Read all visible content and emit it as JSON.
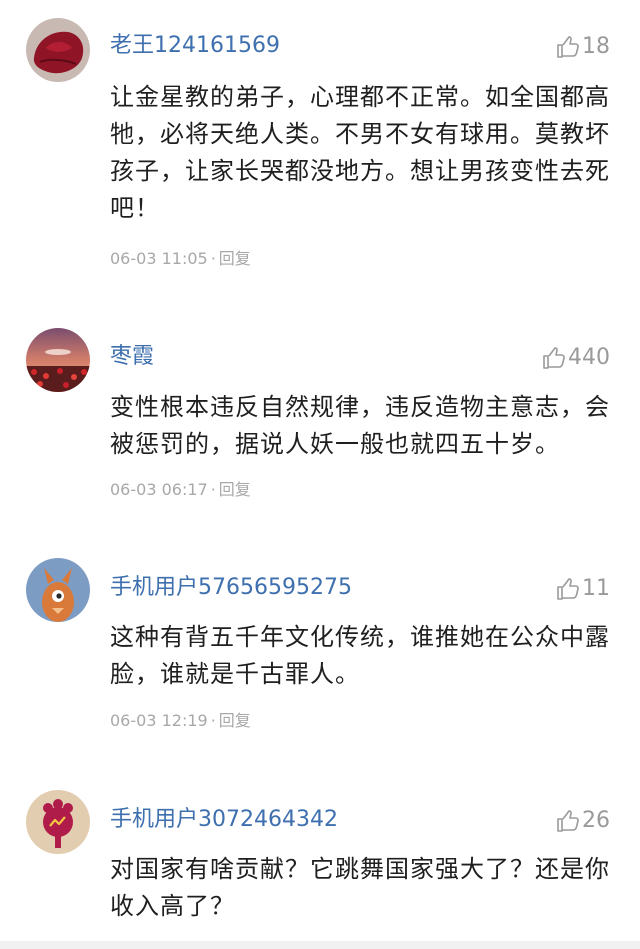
{
  "comments": [
    {
      "username": "老王124161569",
      "likes": "18",
      "text": "让金星教的弟子，心理都不正常。如全国都高牠，必将天绝人类。不男不女有球用。莫教坏孩子，让家长哭都没地方。想让男孩变性去死吧！",
      "time": "06-03 11:05",
      "reply_label": "回复"
    },
    {
      "username": "枣霞",
      "likes": "440",
      "text": "变性根本违反自然规律，违反造物主意志，会被惩罚的，据说人妖一般也就四五十岁。",
      "time": "06-03 06:17",
      "reply_label": "回复"
    },
    {
      "username": "手机用户57656595275",
      "likes": "11",
      "text": "这种有背五千年文化传统，谁推她在公众中露脸，谁就是千古罪人。",
      "time": "06-03 12:19",
      "reply_label": "回复"
    },
    {
      "username": "手机用户3072464342",
      "likes": "26",
      "text": "对国家有啥贡献？它跳舞国家强大了？还是你收入高了？",
      "time": "",
      "reply_label": ""
    }
  ],
  "icons": {
    "like": "thumbs-up-icon",
    "separator": "·"
  },
  "colors": {
    "username": "#3e6fae",
    "meta": "#a8a8a8",
    "text": "#1f1f1f",
    "likes": "#9a9a9a"
  }
}
